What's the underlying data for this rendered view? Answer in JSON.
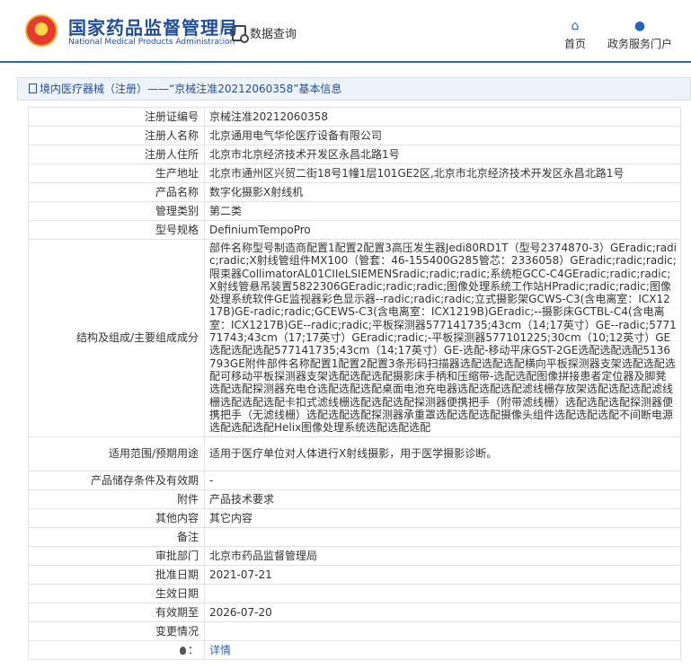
{
  "header": {
    "site_title": "国家药品监督管理局",
    "site_subtitle": "National Medical Products Administration",
    "query_label": "数据查询",
    "home_label": "首页",
    "portal_label": "政务服务门户",
    "icons": {
      "home": "home-icon",
      "portal": "user-icon",
      "query": "search-doc-icon"
    },
    "accent_color": "#2a63b7"
  },
  "breadcrumb": "境内医疗器械（注册）——“京械注准20212060358”基本信息",
  "rows": [
    {
      "key": "注册证编号",
      "value": "京械注准20212060358"
    },
    {
      "key": "注册人名称",
      "value": "北京通用电气华伦医疗设备有限公司"
    },
    {
      "key": "注册人住所",
      "value": "北京市北京经济技术开发区永昌北路1号"
    },
    {
      "key": "生产地址",
      "value": "北京市通州区兴贸二街18号1幢1层101GE2区,北京市北京经济技术开发区永昌北路1号"
    },
    {
      "key": "产品名称",
      "value": "数字化摄影X射线机"
    },
    {
      "key": "管理类别",
      "value": "第二类"
    },
    {
      "key": "型号规格",
      "value": "DefiniumTempoPro"
    },
    {
      "key": "结构及组成/主要组成成分",
      "value": "部件名称型号制造商配置1配置2配置3高压发生器Jedi80RD1T（型号2374870-3）GEradic;radic;radic;X射线管组件MX100（管套：46-155400G285管芯：2336058）GEradic;radic;radic;限束器CollimatorAL01CIIeLSIEMENSradic;radic;radic;系统柜GCC-C4GEradic;radic;radic;X射线管悬吊装置5822306GEradic;radic;radic;图像处理系统工作站HPradic;radic;radic;图像处理系统软件GE监视器彩色显示器--radic;radic;radic;立式摄影架GCWS-C3(含电离室：ICX1217B)GE-radic;radic;GCEWS-C3(含电离室：ICX1219B)GEradic;--摄影床GCTBL-C4(含电离室：ICX1217B)GE--radic;radic;平板探测器577141735;43cm（14;17英寸）GE--radic;577171743;43cm（17;17英寸）GEradic;radic;-平板探测器577101225;30cm（10;12英寸）GE选配选配选配577141735;43cm（14;17英寸）GE-选配-移动平床GST-2GE选配选配选配5136793GE附件部件名称配置1配置2配置3条形码扫描器选配选配选配横向平板探测器支架选配选配选配可移动平板探测器支架选配选配选配摄影床手柄和压缩带-选配选配图像拼接患者定位器及脚凳选配选配探测器充电仓选配选配选配桌面电池充电器选配选配选配滤线栅存放架选配选配选配滤线栅选配选配选配卡扣式滤线栅选配选配选配探测器便携把手（附带滤线栅）选配选配选配探测器便携把手（无滤线栅）选配选配选配探测器承重罩选配选配选配摄像头组件选配选配选配不间断电源选配选配选配Helix图像处理系统选配选配选配"
    },
    {
      "key": "适用范围/预期用途",
      "value": "适用于医疗单位对人体进行X射线摄影，用于医学摄影诊断。"
    },
    {
      "key": "产品储存条件及有效期",
      "value": "-"
    },
    {
      "key": "附件",
      "value": "产品技术要求"
    },
    {
      "key": "其他内容",
      "value": "其它内容"
    },
    {
      "key": "备注",
      "value": ""
    },
    {
      "key": "审批部门",
      "value": "北京市药品监督管理局"
    },
    {
      "key": "批准日期",
      "value": "2021-07-21"
    },
    {
      "key": "生效日期",
      "value": ""
    },
    {
      "key": "有效期至",
      "value": "2026-07-20"
    },
    {
      "key": "变更情况",
      "value": ""
    }
  ],
  "footer_row": {
    "icon": "lightbulb-icon",
    "value": "详情"
  }
}
